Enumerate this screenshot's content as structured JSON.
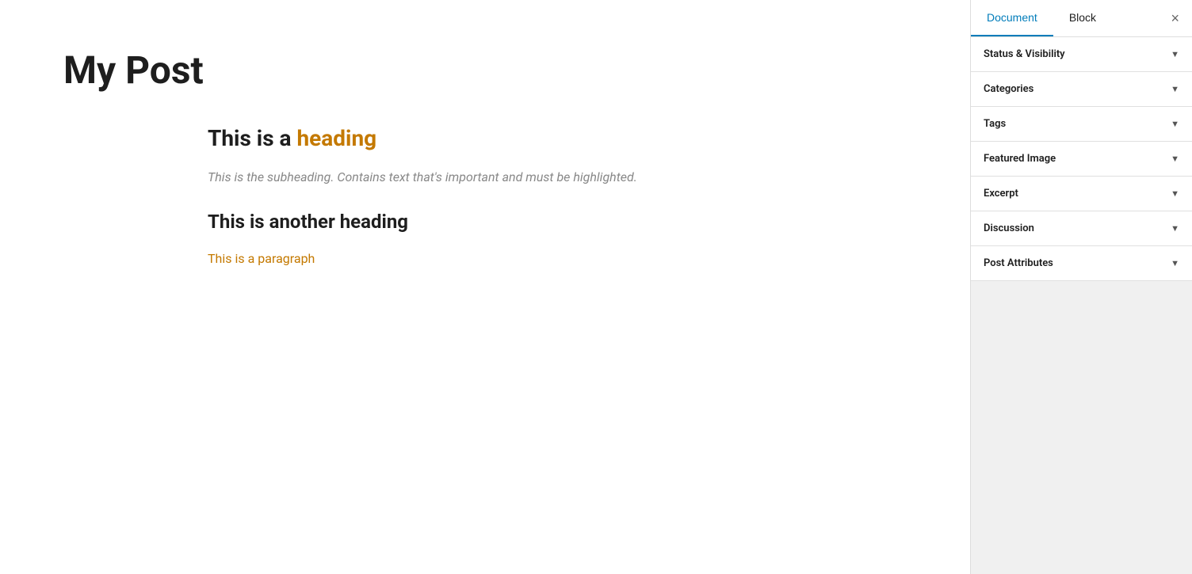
{
  "editor": {
    "title": "My Post",
    "content": {
      "heading1_prefix": "This is a ",
      "heading1_highlight": "heading",
      "subheading": "This is the subheading. Contains text that's important and must be highlighted.",
      "heading2": "This is another heading",
      "paragraph": "This is a paragraph"
    }
  },
  "sidebar": {
    "tab_document": "Document",
    "tab_block": "Block",
    "close_label": "×",
    "sections": [
      {
        "id": "status-visibility",
        "label": "Status & Visibility"
      },
      {
        "id": "categories",
        "label": "Categories"
      },
      {
        "id": "tags",
        "label": "Tags"
      },
      {
        "id": "featured-image",
        "label": "Featured Image"
      },
      {
        "id": "excerpt",
        "label": "Excerpt"
      },
      {
        "id": "discussion",
        "label": "Discussion"
      },
      {
        "id": "post-attributes",
        "label": "Post Attributes"
      }
    ]
  }
}
